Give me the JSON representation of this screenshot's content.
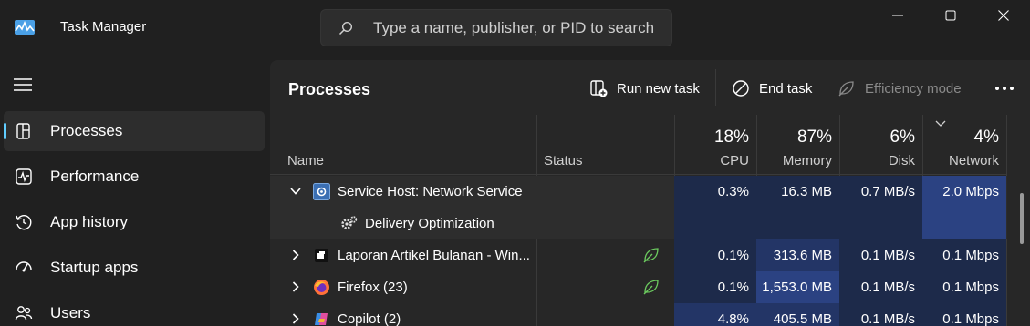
{
  "app": {
    "title": "Task Manager"
  },
  "search": {
    "placeholder": "Type a name, publisher, or PID to search"
  },
  "sidebar": {
    "items": [
      {
        "label": "Processes",
        "icon": "processes-icon",
        "active": true
      },
      {
        "label": "Performance",
        "icon": "performance-icon"
      },
      {
        "label": "App history",
        "icon": "history-icon"
      },
      {
        "label": "Startup apps",
        "icon": "startup-icon"
      },
      {
        "label": "Users",
        "icon": "users-icon"
      }
    ]
  },
  "toolbar": {
    "page_title": "Processes",
    "run_new_task": "Run new task",
    "end_task": "End task",
    "efficiency_mode": "Efficiency mode"
  },
  "columns": {
    "name": "Name",
    "status": "Status",
    "cpu": {
      "label": "CPU",
      "total": "18%"
    },
    "memory": {
      "label": "Memory",
      "total": "87%"
    },
    "disk": {
      "label": "Disk",
      "total": "6%"
    },
    "network": {
      "label": "Network",
      "total": "4%"
    }
  },
  "rows": [
    {
      "name": "Service Host: Network Service",
      "status": "",
      "cpu": "0.3%",
      "memory": "16.3 MB",
      "disk": "0.7 MB/s",
      "network": "2.0 Mbps",
      "expanded": true,
      "icon": "service-host-icon"
    },
    {
      "name": "Delivery Optimization",
      "status": "",
      "cpu": "",
      "memory": "",
      "disk": "",
      "network": "",
      "child": true,
      "icon": "gears-icon"
    },
    {
      "name": "Laporan Artikel Bulanan - Win...",
      "status": "efficiency",
      "cpu": "0.1%",
      "memory": "313.6 MB",
      "disk": "0.1 MB/s",
      "network": "0.1 Mbps",
      "icon": "app-icon"
    },
    {
      "name": "Firefox (23)",
      "status": "efficiency",
      "cpu": "0.1%",
      "memory": "1,553.0 MB",
      "disk": "0.1 MB/s",
      "network": "0.1 Mbps",
      "icon": "firefox-icon"
    },
    {
      "name": "Copilot (2)",
      "status": "",
      "cpu": "4.8%",
      "memory": "405.5 MB",
      "disk": "0.1 MB/s",
      "network": "0.1 Mbps",
      "icon": "copilot-icon"
    }
  ],
  "colors": {
    "background": "#202020",
    "panel": "#272727",
    "accent": "#60cdff",
    "heat_light": "#1d2a4a",
    "heat_medium": "#233566",
    "heat_strong": "#2b4282",
    "leaf_green": "#6ccb5f"
  }
}
